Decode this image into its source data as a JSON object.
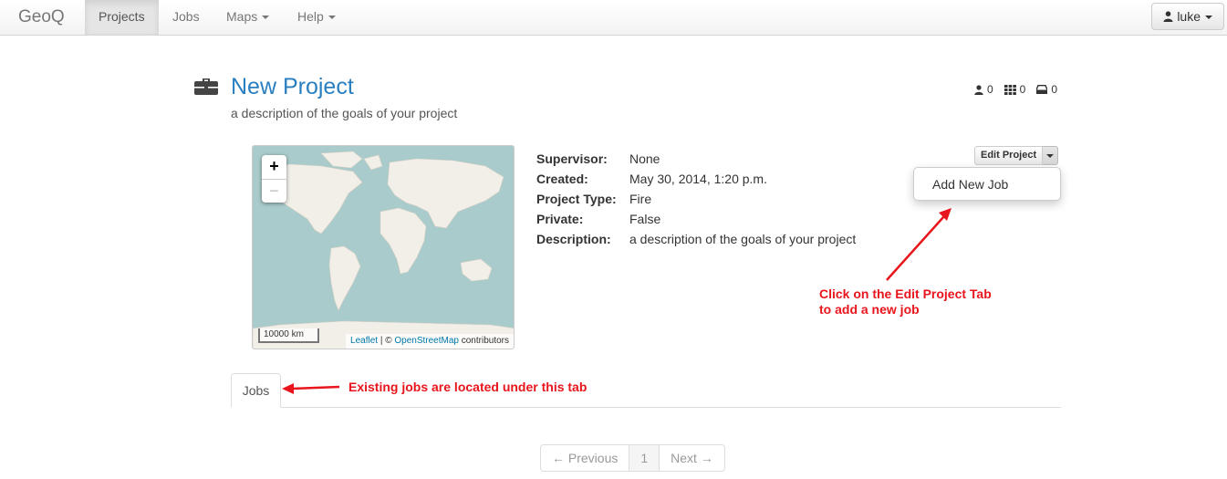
{
  "navbar": {
    "brand": "GeoQ",
    "items": [
      {
        "label": "Projects",
        "active": true,
        "dropdown": false
      },
      {
        "label": "Jobs",
        "active": false,
        "dropdown": false
      },
      {
        "label": "Maps",
        "active": false,
        "dropdown": true
      },
      {
        "label": "Help",
        "active": false,
        "dropdown": true
      }
    ],
    "user": {
      "name": "luke",
      "icon": "user-icon"
    }
  },
  "project": {
    "icon": "briefcase-icon",
    "title": "New Project",
    "description": "a description of the goals of your project",
    "stats": [
      {
        "icon": "user-icon",
        "value": "0"
      },
      {
        "icon": "grid-icon",
        "value": "0"
      },
      {
        "icon": "inbox-icon",
        "value": "0"
      }
    ]
  },
  "map": {
    "zoom_in": "+",
    "zoom_out": "−",
    "scale": "10000 km",
    "attribution": {
      "leaflet": "Leaflet",
      "sep": " | © ",
      "osm": "OpenStreetMap",
      "suffix": " contributors"
    }
  },
  "details": [
    {
      "key": "Supervisor:",
      "value": "None"
    },
    {
      "key": "Created:",
      "value": "May 30, 2014, 1:20 p.m."
    },
    {
      "key": "Project Type:",
      "value": "Fire"
    },
    {
      "key": "Private:",
      "value": "False"
    },
    {
      "key": "Description:",
      "value": "a description of the goals of your project"
    }
  ],
  "edit_menu": {
    "button_label": "Edit Project",
    "items": [
      "Add New Job"
    ]
  },
  "annotations": {
    "edit_line1": "Click on the Edit Project Tab",
    "edit_line2": "to add a new job",
    "jobs_note": "Existing jobs are located under this tab",
    "color": "#e8151c"
  },
  "tabs": [
    "Jobs"
  ],
  "pager": {
    "previous": "← Previous",
    "current": "1",
    "next": "Next →"
  },
  "colors": {
    "link": "#2a7fc0",
    "map_water": "#aacbcb",
    "map_land": "#f2efe9"
  }
}
